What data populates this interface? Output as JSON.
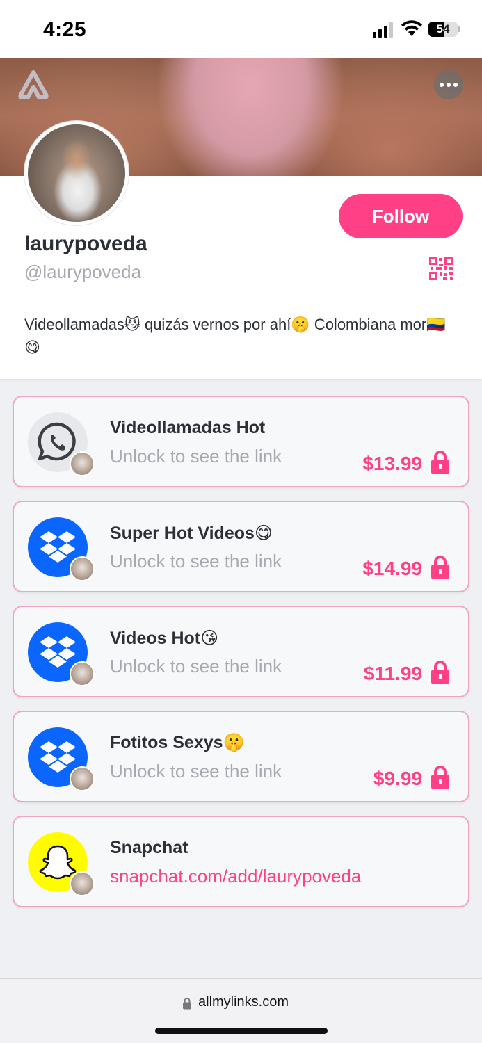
{
  "status_bar": {
    "time": "4:25",
    "battery": "54",
    "battery_level": 0.54
  },
  "profile": {
    "display_name": "laurypoveda",
    "handle": "@laurypoveda",
    "bio": "Videollamadas😼 quizás vernos por ahí🤫 Colombiana mor🇨🇴 😋",
    "follow_label": "Follow"
  },
  "links": [
    {
      "icon": "whatsapp-icon",
      "title": "Videollamadas Hot",
      "subtitle": "Unlock to see the link",
      "price": "$13.99",
      "locked": true
    },
    {
      "icon": "dropbox-icon",
      "title": "Super Hot Videos😋",
      "subtitle": "Unlock to see the link",
      "price": "$14.99",
      "locked": true
    },
    {
      "icon": "dropbox-icon",
      "title": "Videos Hot😘",
      "subtitle": "Unlock to see the link",
      "price": "$11.99",
      "locked": true
    },
    {
      "icon": "dropbox-icon",
      "title": "Fotitos Sexys🤫",
      "subtitle": "Unlock to see the link",
      "price": "$9.99",
      "locked": true
    },
    {
      "icon": "snapchat-icon",
      "title": "Snapchat",
      "subtitle": "snapchat.com/add/laurypoveda",
      "locked": false
    }
  ],
  "browser": {
    "url": "allmylinks.com"
  },
  "colors": {
    "accent": "#ff3f86",
    "card_border": "#f2a5c0",
    "dropbox": "#0a66ff",
    "snapchat": "#fffc00"
  }
}
